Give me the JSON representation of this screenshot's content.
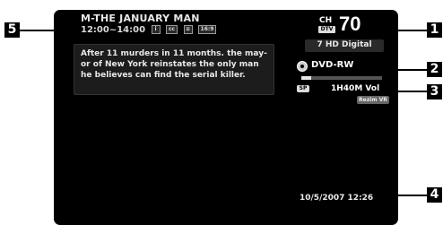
{
  "callouts": {
    "one": "1",
    "two": "2",
    "three": "3",
    "four": "4",
    "five": "5"
  },
  "program": {
    "title": "M-THE JANUARY MAN",
    "time": "12:00~14:00",
    "icons": [
      "i",
      "cc",
      "≡",
      "16:9"
    ],
    "synopsis": "After 11 murders in 11 months. the may- or of New York reinstates the only man he believes can find the serial killer."
  },
  "channel": {
    "label": "CH",
    "badge": "DTV",
    "number": "70",
    "name": "7 HD Digital"
  },
  "disc": {
    "icon": "disc-icon",
    "label": "DVD-RW",
    "used_fraction": 0.12
  },
  "recording": {
    "badge": "SP",
    "remaining": "1H40M Vol",
    "mode": "Rezim VR"
  },
  "clock": "10/5/2007 12:26",
  "colors": {
    "screen": "#000000",
    "text": "#e8e8e8",
    "callout_bg": "#000000"
  }
}
